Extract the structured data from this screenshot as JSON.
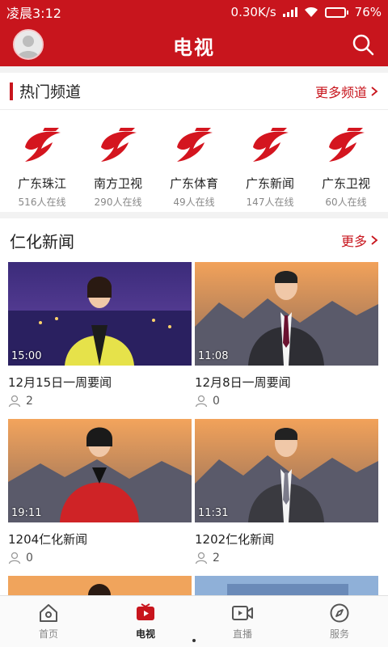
{
  "status": {
    "time": "凌晨3:12",
    "speed": "0.30K/s",
    "battery": "76%",
    "battery_level": 0.76
  },
  "header": {
    "title": "电视"
  },
  "hot": {
    "title": "热门频道",
    "more": "更多频道",
    "channels": [
      {
        "name": "广东珠江",
        "online": "516人在线"
      },
      {
        "name": "南方卫视",
        "online": "290人在线"
      },
      {
        "name": "广东体育",
        "online": "49人在线"
      },
      {
        "name": "广东新闻",
        "online": "147人在线"
      },
      {
        "name": "广东卫视",
        "online": "60人在线"
      }
    ]
  },
  "news": {
    "title": "仁化新闻",
    "more": "更多",
    "items": [
      {
        "title": "12月15日一周要闻",
        "duration": "15:00",
        "views": "2"
      },
      {
        "title": "12月8日一周要闻",
        "duration": "11:08",
        "views": "0"
      },
      {
        "title": "1204仁化新闻",
        "duration": "19:11",
        "views": "0"
      },
      {
        "title": "1202仁化新闻",
        "duration": "11:31",
        "views": "2"
      }
    ]
  },
  "nav": {
    "items": [
      {
        "label": "首页",
        "icon": "home-icon"
      },
      {
        "label": "电视",
        "icon": "tv-icon"
      },
      {
        "label": "直播",
        "icon": "live-video-icon"
      },
      {
        "label": "服务",
        "icon": "compass-icon"
      }
    ],
    "active": "电视"
  },
  "colors": {
    "brand": "#c8151d"
  }
}
